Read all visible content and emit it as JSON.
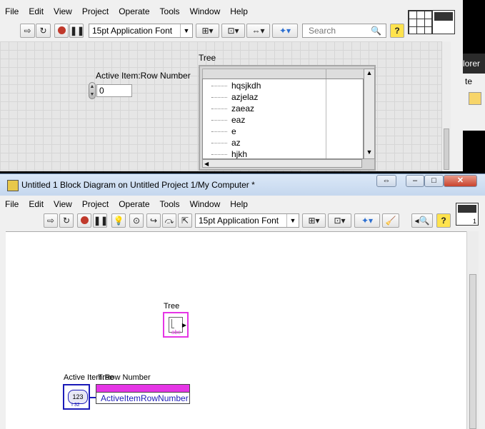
{
  "front_panel": {
    "menu": [
      "File",
      "Edit",
      "View",
      "Project",
      "Operate",
      "Tools",
      "Window",
      "Help"
    ],
    "font_ring": "15pt Application Font",
    "search_placeholder": "Search",
    "help_glyph": "?",
    "numeric_label": "Active Item:Row Number",
    "numeric_value": "0",
    "tree_label": "Tree",
    "tree_items": [
      "hqsjkdh",
      "azjelaz",
      "zaeaz",
      "eaz",
      "e",
      "az",
      "hjkh"
    ],
    "right_partial": {
      "tab_text": "lorer",
      "tab_text2": "te"
    }
  },
  "block_diagram": {
    "title": "Untitled 1 Block Diagram on Untitled Project 1/My Computer *",
    "menu": [
      "File",
      "Edit",
      "View",
      "Project",
      "Operate",
      "Tools",
      "Window",
      "Help"
    ],
    "font_ring": "15pt Application Font",
    "tree_terminal_label": "Tree",
    "tree_terminal_text": "abc",
    "numeric_terminal_label": "Active Item:Row Number",
    "numeric_terminal_text": "123",
    "numeric_terminal_type": "I 32",
    "property_node_title": "Tree",
    "property_node_property": "ActiveItemRowNumber",
    "icon_pane_number": "1"
  },
  "colors": {
    "tree_wire": "#e535e5",
    "numeric_wire": "#1a1ab8",
    "titlebar": "#c5d7ee",
    "panel_grid": "#d6d6d6"
  }
}
